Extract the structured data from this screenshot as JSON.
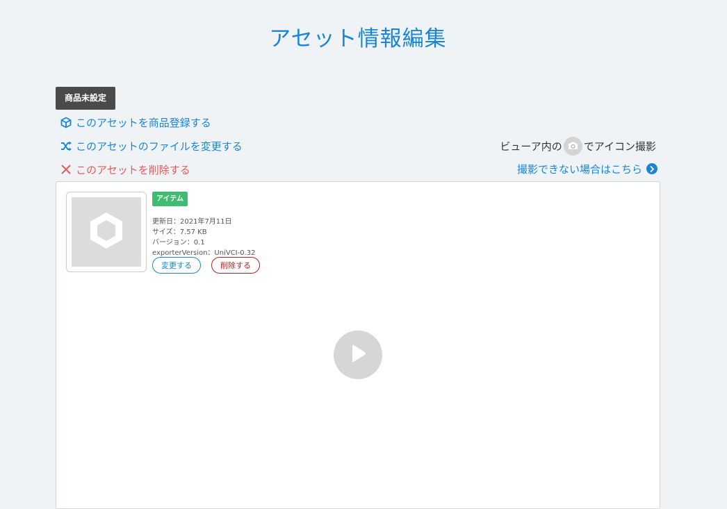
{
  "page": {
    "title": "アセット情報編集"
  },
  "status_badge": "商品未設定",
  "actions": {
    "register_product": "このアセットを商品登録する",
    "change_file": "このアセットのファイルを変更する",
    "delete_asset": "このアセットを削除する"
  },
  "hint": {
    "prefix": "ビューア内の",
    "suffix": "でアイコン撮影",
    "help_link": "撮影できない場合はこちら"
  },
  "asset": {
    "type_badge": "アイテム",
    "updated": "更新日：2021年7月11日",
    "size": "サイズ：7.57 KB",
    "version": "バージョン：0.1",
    "exporter": "exporterVersion：UniVCI-0.32",
    "edit_button": "変更する",
    "delete_button": "削除する"
  },
  "icons": {
    "register": "cube-icon",
    "change": "shuffle-icon",
    "delete": "close-icon",
    "camera": "camera-icon",
    "help": "chevron-right-icon",
    "thumbnail": "hexagon-icon",
    "play": "play-icon"
  },
  "colors": {
    "accent": "#1a85d6",
    "danger": "#e55a5a",
    "badge_dark": "#4a4a4a",
    "badge_green": "#3ebd72",
    "background": "#f0f3f6"
  }
}
